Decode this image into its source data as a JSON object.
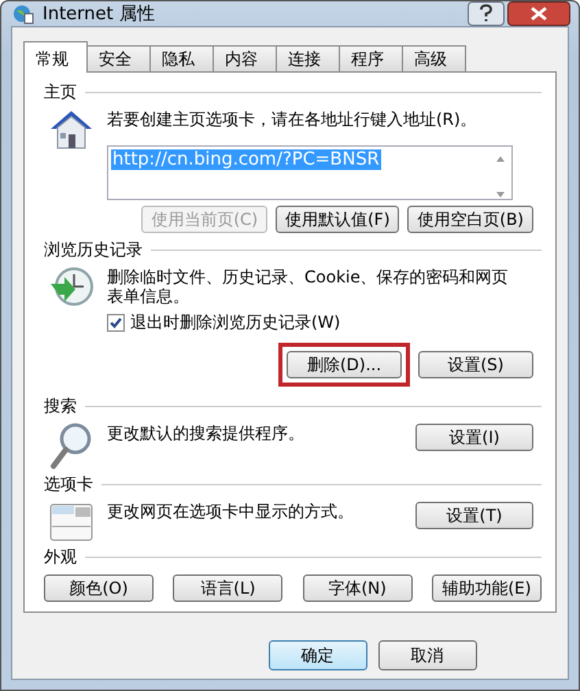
{
  "window": {
    "title": "Internet 属性"
  },
  "tabs": [
    {
      "label": "常规",
      "selected": true
    },
    {
      "label": "安全",
      "selected": false
    },
    {
      "label": "隐私",
      "selected": false
    },
    {
      "label": "内容",
      "selected": false
    },
    {
      "label": "连接",
      "selected": false
    },
    {
      "label": "程序",
      "selected": false
    },
    {
      "label": "高级",
      "selected": false
    }
  ],
  "sections": [
    {
      "kind": "homepage",
      "title": "主页",
      "description": "若要创建主页选项卡，请在各地址行键入地址(R)。",
      "url": "http://cn.bing.com/?PC=BNSR",
      "buttons": [
        {
          "label": "使用当前页(C)",
          "disabled": true,
          "highlighted": false
        },
        {
          "label": "使用默认值(F)",
          "disabled": false,
          "highlighted": false
        },
        {
          "label": "使用空白页(B)",
          "disabled": false,
          "highlighted": false
        }
      ]
    },
    {
      "kind": "history",
      "title": "浏览历史记录",
      "description": "删除临时文件、历史记录、Cookie、保存的密码和网页表单信息。",
      "checkbox": {
        "label": "退出时删除浏览历史记录(W)",
        "checked": true
      },
      "buttons": [
        {
          "label": "删除(D)...",
          "disabled": false,
          "highlighted": true
        },
        {
          "label": "设置(S)",
          "disabled": false,
          "highlighted": false
        }
      ]
    },
    {
      "kind": "search",
      "title": "搜索",
      "description": "更改默认的搜索提供程序。",
      "buttons": [
        {
          "label": "设置(I)",
          "disabled": false,
          "highlighted": false
        }
      ]
    },
    {
      "kind": "tabs",
      "title": "选项卡",
      "description": "更改网页在选项卡中显示的方式。",
      "buttons": [
        {
          "label": "设置(T)",
          "disabled": false,
          "highlighted": false
        }
      ]
    },
    {
      "kind": "appearance",
      "title": "外观",
      "buttons": [
        {
          "label": "颜色(O)",
          "disabled": false,
          "highlighted": false
        },
        {
          "label": "语言(L)",
          "disabled": false,
          "highlighted": false
        },
        {
          "label": "字体(N)",
          "disabled": false,
          "highlighted": false
        },
        {
          "label": "辅助功能(E)",
          "disabled": false,
          "highlighted": false
        }
      ]
    }
  ],
  "footer": [
    {
      "label": "确定",
      "default": true
    },
    {
      "label": "取消",
      "default": false
    }
  ]
}
